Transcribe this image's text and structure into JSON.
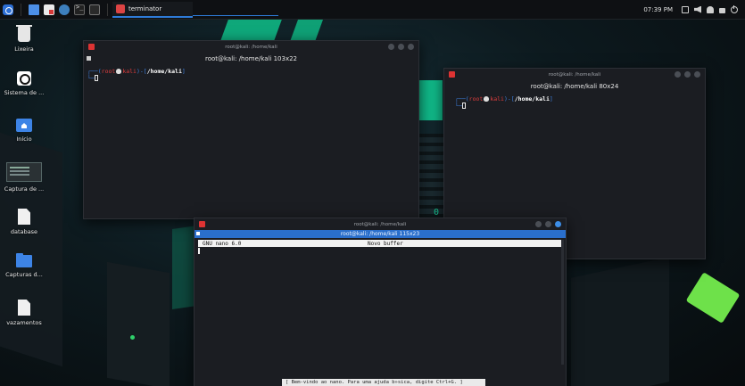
{
  "panel": {
    "launcher_icons": [
      "kali-menu-icon",
      "folder-icon",
      "text-editor-icon",
      "browser-icon",
      "terminal-icon",
      "app-icon"
    ],
    "task_label": "terminator",
    "clock": "07:39 PM",
    "tray_icons": [
      "screen-icon",
      "volume-icon",
      "notification-bell-icon",
      "lock-icon",
      "power-icon"
    ]
  },
  "desktop": {
    "icons": [
      {
        "label": "Lixeira",
        "icon": "trash-icon"
      },
      {
        "label": "Sistema de ...",
        "icon": "system-icon"
      },
      {
        "label": "Início",
        "icon": "home-folder-icon"
      },
      {
        "label": "Captura de ...",
        "icon": "screenshot-thumbnail-icon"
      },
      {
        "label": "database",
        "icon": "file-icon"
      },
      {
        "label": "Capturas d...",
        "icon": "folder-icon"
      },
      {
        "label": "vazamentos",
        "icon": "file-icon"
      }
    ]
  },
  "windows": {
    "term1": {
      "title": "root@kali: /home/kali",
      "header": "root@kali: /home/kali 103x22",
      "prompt_open": "┌──(",
      "prompt_user": "root",
      "prompt_host": "kali",
      "prompt_mid": ")-[",
      "prompt_path": "/home/kali",
      "prompt_close": "]",
      "prompt_line2": "└─"
    },
    "term2": {
      "title": "root@kali: /home/kali",
      "header": "root@kali: /home/kali 80x24",
      "prompt_open": "┌──(",
      "prompt_user": "root",
      "prompt_host": "kali",
      "prompt_mid": ")-[",
      "prompt_path": "/home/kali",
      "prompt_close": "]",
      "prompt_line2": "└─"
    },
    "nano": {
      "title": "root@kali: /home/kali",
      "header": "root@kali: /home/kali 115x23",
      "version": "GNU nano 6.0",
      "buffer": "Novo buffer",
      "status": "[ Bem-vindo ao nano. Para uma ajuda b»sica, digite Ctrl+G. ]"
    }
  },
  "wallpaper": {
    "digit": "0",
    "colors": {
      "accent_green": "#12d39a",
      "monitor_green": "#6ee14a",
      "panel_blue": "#2e7bd8"
    }
  }
}
